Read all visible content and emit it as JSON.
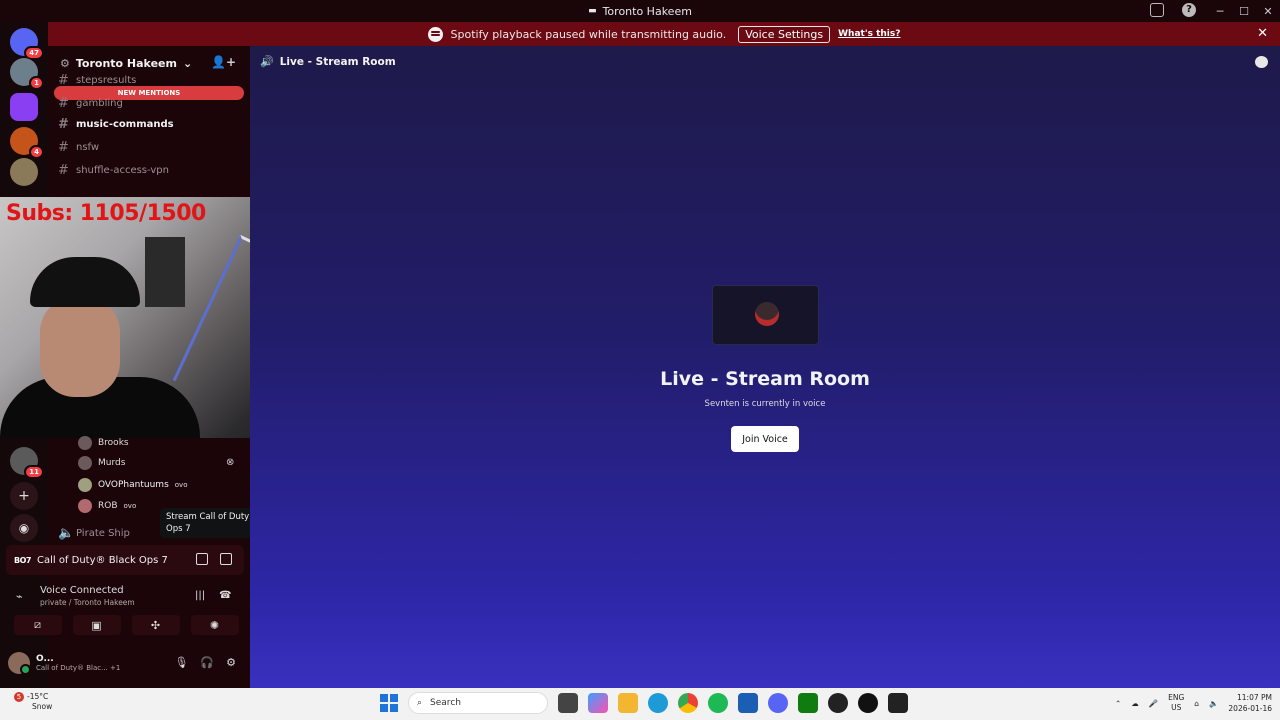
{
  "window": {
    "title": "Toronto Hakeem",
    "controls": [
      "─",
      "☐",
      "✕"
    ]
  },
  "notice": {
    "text": "Spotify playback paused while transmitting audio.",
    "button_label": "Voice Settings",
    "link_label": "What's this?",
    "close": "✕"
  },
  "guilds": [
    {
      "name": "direct-messages",
      "badge": "47",
      "color": "#5865f2"
    },
    {
      "name": "server-1",
      "badge": "1",
      "color": "#6d7f8a"
    },
    {
      "name": "server-2",
      "badge": "",
      "color": "#8a3ff2"
    },
    {
      "name": "server-3",
      "badge": "4",
      "color": "#c4541a"
    },
    {
      "name": "server-4",
      "badge": "",
      "color": "#8a7a5a"
    },
    {
      "name": "server-5",
      "badge": "11",
      "color": "#5a5a5a"
    }
  ],
  "server": {
    "name": "Toronto Hakeem",
    "new_mentions": "NEW MENTIONS"
  },
  "channels": [
    {
      "name": "stepsresults",
      "bright": false
    },
    {
      "name": "gambling",
      "bright": false
    },
    {
      "name": "music-commands",
      "bright": true
    },
    {
      "name": "nsfw",
      "bright": false
    },
    {
      "name": "shuffle-access-vpn",
      "bright": false
    }
  ],
  "overlay": {
    "subs_text": "Subs: 1105/1500"
  },
  "voice_members": [
    {
      "name": "Brooks",
      "tag": ""
    },
    {
      "name": "Murds",
      "tag": ""
    },
    {
      "name": "OVOPhantuums",
      "tag": "ovo"
    },
    {
      "name": "ROB",
      "tag": "ovo"
    }
  ],
  "voice_channel_2": "Pirate Ship",
  "tooltip": "Stream Call of Duty® Black Ops 7",
  "activity": {
    "game_tag": "BO7",
    "game": "Call of Duty® Black Ops 7"
  },
  "voice_connected": {
    "title": "Voice Connected",
    "subtitle": "private / Toronto Hakeem"
  },
  "user": {
    "name": "O...",
    "status": "Call of Duty® Blac...",
    "extra": "+1"
  },
  "main": {
    "header": "Live - Stream Room",
    "title": "Live - Stream Room",
    "subtitle": "Sevnten is currently in voice",
    "join_label": "Join Voice"
  },
  "taskbar": {
    "weather_temp": "-15°C",
    "weather_desc": "Snow",
    "weather_badge": "5",
    "search_placeholder": "Search",
    "lang": "ENG",
    "region": "US",
    "time": "11:07 PM",
    "date": "2026-01-16"
  }
}
